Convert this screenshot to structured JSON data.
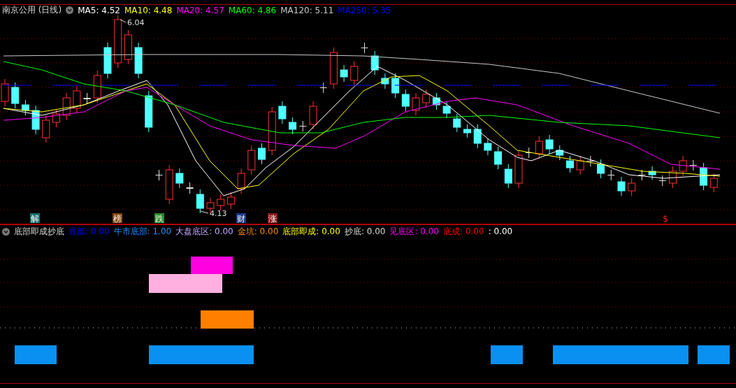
{
  "stock_header": {
    "title": "南京公用 (日线)",
    "moving_averages": [
      {
        "text": "MA5: 4.52",
        "color": "#ffffff"
      },
      {
        "text": "MA10: 4.48",
        "color": "#ffff00"
      },
      {
        "text": "MA20: 4.57",
        "color": "#ff00ff"
      },
      {
        "text": "MA60: 4.86",
        "color": "#00ff00"
      },
      {
        "text": "MA120: 5.11",
        "color": "#c8c8c8"
      },
      {
        "text": "MA250: 5.35",
        "color": "#0000ff"
      }
    ]
  },
  "price_chart": {
    "high_label": "6.04",
    "low_label": "4.13",
    "event_markers": [
      {
        "kind": "badge",
        "text": "解",
        "color": "#1a7070"
      },
      {
        "kind": "badge",
        "text": "榜",
        "color": "#8a4a10"
      },
      {
        "kind": "badge",
        "text": "跌",
        "color": "#2a8a2a"
      },
      {
        "kind": "badge",
        "text": "财",
        "color": "#1a3a8a"
      },
      {
        "kind": "badge",
        "text": "涨",
        "color": "#8a1a1a"
      },
      {
        "kind": "glyph",
        "text": "$",
        "color": "#ff2020"
      }
    ]
  },
  "indicator": {
    "name": "底部即成抄底",
    "readings": [
      {
        "text": "底部: 0.00",
        "color": "#0000ff"
      },
      {
        "text": "牛市底部: 1.00",
        "color": "#1e90ff"
      },
      {
        "text": "大盘底区: 0.00",
        "color": "#c0a8ff"
      },
      {
        "text": "金坑: 0.00",
        "color": "#ff8c00"
      },
      {
        "text": "底部即成: 0.00",
        "color": "#ffff00"
      },
      {
        "text": "抄底: 0.00",
        "color": "#d8d8d8"
      },
      {
        "text": "见底区: 0.00",
        "color": "#ff00ff"
      },
      {
        "text": "底成: 0.00",
        "color": "#ff0000"
      },
      {
        "text": ": 0.00",
        "color": "#ffffff"
      }
    ]
  }
}
